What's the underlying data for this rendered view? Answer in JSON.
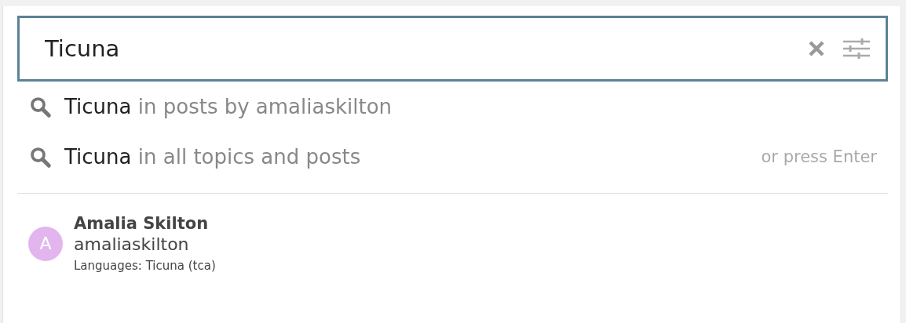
{
  "search": {
    "value": "Ticuna"
  },
  "suggestions": [
    {
      "term": "Ticuna",
      "context": "in posts by amaliaskilton"
    },
    {
      "term": "Ticuna",
      "context": "in all topics and posts",
      "hint": "or press Enter"
    }
  ],
  "users": [
    {
      "name": "Amalia Skilton",
      "username": "amaliaskilton",
      "initial": "A",
      "color": "#e3b5ef",
      "details": "Languages: Ticuna (tca)"
    }
  ]
}
